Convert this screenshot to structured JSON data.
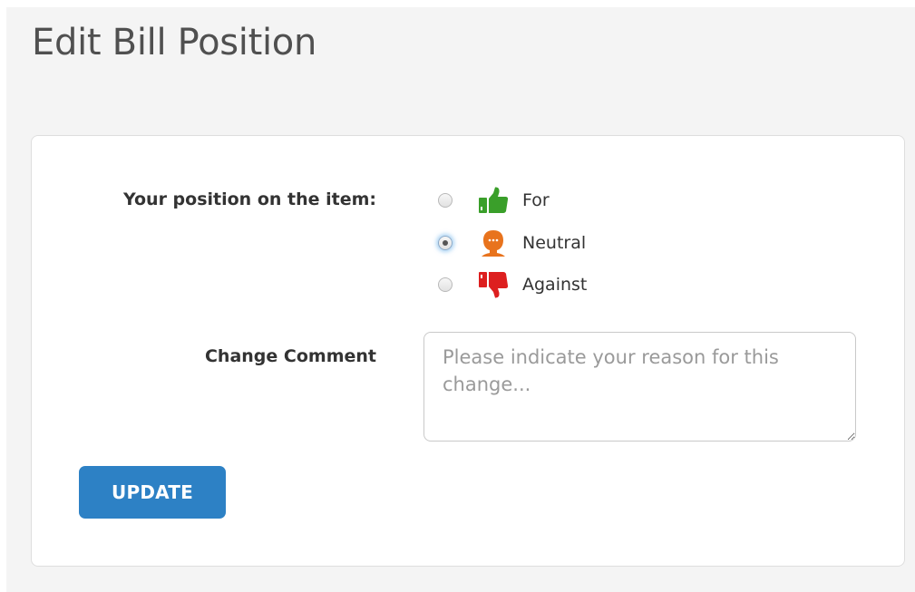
{
  "page": {
    "title": "Edit Bill Position"
  },
  "form": {
    "position_label": "Your position on the item:",
    "options": [
      {
        "label": "For",
        "icon": "thumbs-up-icon",
        "color": "#3a9f2a",
        "selected": false
      },
      {
        "label": "Neutral",
        "icon": "neutral-face-icon",
        "color": "#e8731d",
        "selected": true
      },
      {
        "label": "Against",
        "icon": "thumbs-down-icon",
        "color": "#dd1f1f",
        "selected": false
      }
    ],
    "comment_label": "Change Comment",
    "comment_placeholder": "Please indicate your reason for this change...",
    "comment_value": "",
    "submit_label": "UPDATE"
  },
  "colors": {
    "page_background": "#f4f4f4",
    "card_background": "#ffffff",
    "button_primary": "#2d81c5"
  }
}
